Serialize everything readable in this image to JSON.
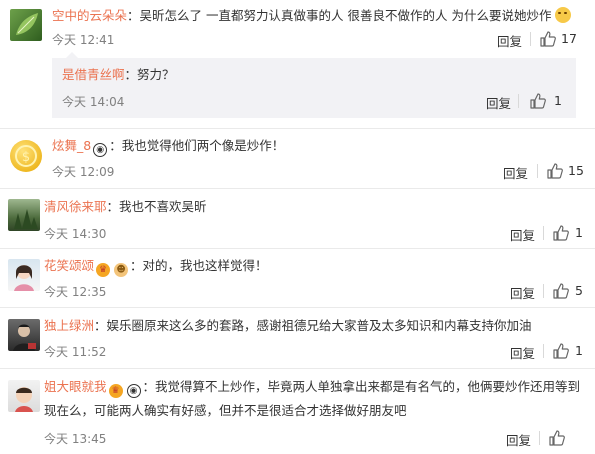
{
  "comments": [
    {
      "username": "空中的云朵朵",
      "text": "吴昕怎么了 一直都努力认真做事的人  很善良不做作的人 为什么要说她炒作",
      "time": "今天 12:41",
      "reply_label": "回复",
      "likes": "17",
      "avatar_icon": "avatar-green-leaf",
      "reply": {
        "username": "是借青丝啊",
        "text": "努力？",
        "time": "今天 14:04",
        "reply_label": "回复",
        "likes": "1"
      }
    },
    {
      "username": "炫舞_8",
      "text": "我也觉得他们两个像是炒作！",
      "time": "今天 12:09",
      "reply_label": "回复",
      "likes": "15",
      "avatar_icon": "avatar-gold-coin",
      "badges": [
        "panda-badge"
      ]
    },
    {
      "username": "清风徐来耶",
      "text": "我也不喜欢吴昕",
      "time": "今天 14:30",
      "reply_label": "回复",
      "likes": "1",
      "avatar_icon": "avatar-forest"
    },
    {
      "username": "花笑颂颂",
      "text": "对的，我也这样觉得！",
      "time": "今天 12:35",
      "reply_label": "回复",
      "likes": "5",
      "avatar_icon": "avatar-girl",
      "badges": [
        "crown-badge",
        "lion-badge"
      ]
    },
    {
      "username": "独上绿洲",
      "text": "娱乐圈原来这么多的套路，感谢祖德兄给大家普及太多知识和内幕支持你加油",
      "time": "今天 11:52",
      "reply_label": "回复",
      "likes": "1",
      "avatar_icon": "avatar-person-dark"
    },
    {
      "username": "姐大眼就我",
      "text_line1": "我觉得算不上炒作，毕竟两人单独拿出来都是有名气的，他俩要炒作还用等到",
      "text_line2": "现在么，可能两人确实有好感，但并不是很适合才选择做好朋友吧",
      "time": "今天 13:45",
      "reply_label": "回复",
      "likes": "",
      "avatar_icon": "avatar-kid",
      "badges": [
        "crown-badge",
        "panda-badge"
      ]
    }
  ],
  "colors": {
    "username": "#eb7350",
    "time": "#808080",
    "text": "#333333",
    "sub_bg": "#f2f2f5"
  }
}
